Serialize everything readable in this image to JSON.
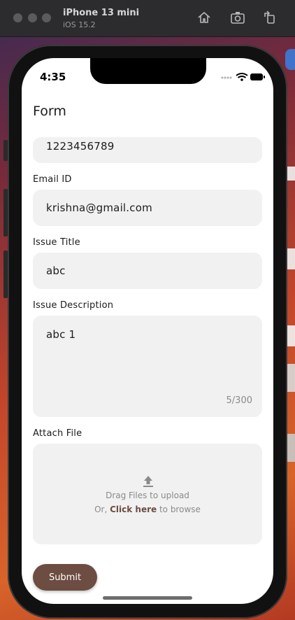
{
  "simulator": {
    "device_name": "iPhone 13 mini",
    "os_version": "iOS 15.2"
  },
  "status_bar": {
    "time": "4:35"
  },
  "form": {
    "title": "Form",
    "fields": {
      "phone_value": "1223456789",
      "email_label": "Email ID",
      "email_value": "krishna@gmail.com",
      "issue_title_label": "Issue Title",
      "issue_title_value": "abc",
      "issue_description_label": "Issue Description",
      "issue_description_value": "abc 1",
      "description_counter": "5/300",
      "attach_label": "Attach File"
    },
    "attach": {
      "drag_text": "Drag Files to upload",
      "browse_prefix": "Or, ",
      "browse_link": "Click here",
      "browse_suffix": " to browse"
    },
    "submit_label": "Submit"
  },
  "colors": {
    "accent": "#6d4c41",
    "field_background": "#f1f1f1"
  },
  "icons": [
    "home-icon",
    "screenshot-icon",
    "rotate-icon",
    "wifi-icon",
    "battery-icon",
    "signal-dots-icon",
    "upload-icon"
  ]
}
